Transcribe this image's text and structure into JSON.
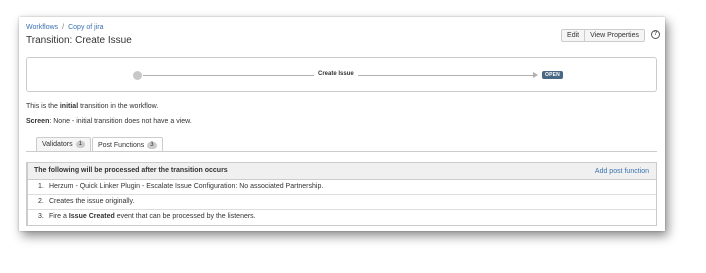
{
  "breadcrumb": {
    "workflows": "Workflows",
    "separator": "/",
    "copy": "Copy of jira"
  },
  "page_title": "Transition: Create Issue",
  "toolbar": {
    "edit_label": "Edit",
    "view_properties_label": "View Properties",
    "help_icon": "?"
  },
  "diagram": {
    "transition_label": "Create Issue",
    "status_label": "OPEN",
    "status_color": "#4a6785"
  },
  "description": {
    "prefix": "This is the ",
    "bold": "initial",
    "suffix": " transition in the workflow."
  },
  "screen": {
    "label": "Screen",
    "value": ": None - initial transition does not have a view."
  },
  "tabs": [
    {
      "label": "Validators",
      "count": "1"
    },
    {
      "label": "Post Functions",
      "count": "3"
    }
  ],
  "post_functions": {
    "header": "The following will be processed after the transition occurs",
    "add_label": "Add post function",
    "rows": [
      {
        "num": "1.",
        "text": "Herzum - Quick Linker Plugin - Escalate Issue Configuration: No associated Partnership."
      },
      {
        "num": "2.",
        "text": "Creates the issue originally."
      },
      {
        "num": "3.",
        "prefix": "Fire a ",
        "bold": "Issue Created",
        "suffix": " event that can be processed by the listeners."
      }
    ]
  },
  "link_color": "#3b73af"
}
